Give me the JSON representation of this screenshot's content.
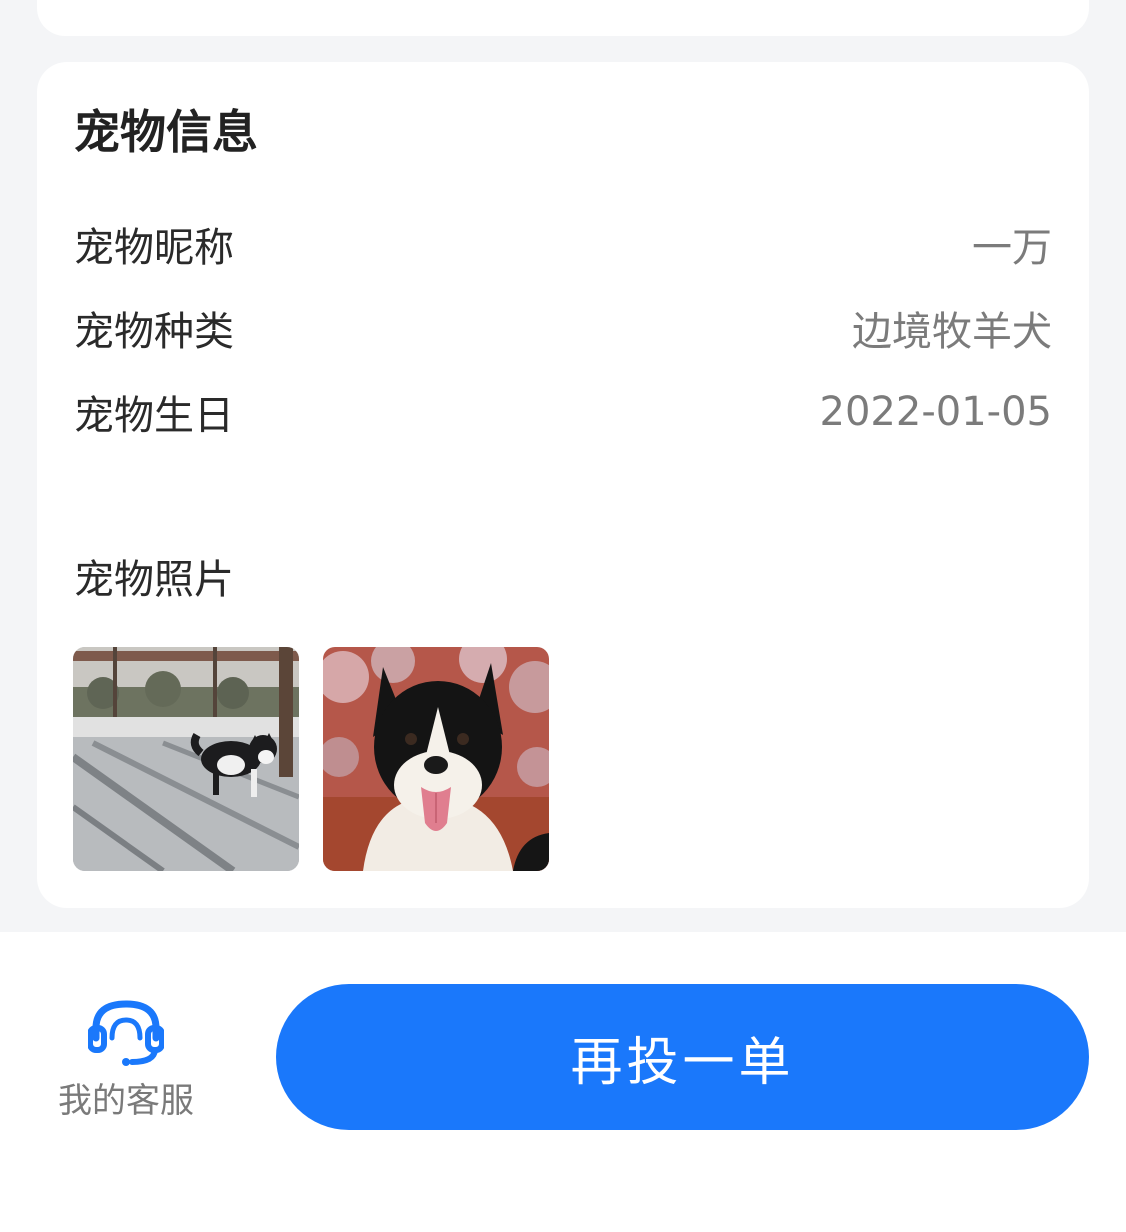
{
  "pet_info": {
    "title": "宠物信息",
    "rows": [
      {
        "label": "宠物昵称",
        "value": "一万"
      },
      {
        "label": "宠物种类",
        "value": "边境牧羊犬"
      },
      {
        "label": "宠物生日",
        "value": "2022-01-05"
      }
    ],
    "photos_label": "宠物照片"
  },
  "bottom_bar": {
    "customer_service_label": "我的客服",
    "customer_service_icon": "headset-icon",
    "primary_button_label": "再投一单"
  },
  "colors": {
    "accent": "#1a78fb",
    "background": "#f4f5f7",
    "card": "#ffffff"
  }
}
